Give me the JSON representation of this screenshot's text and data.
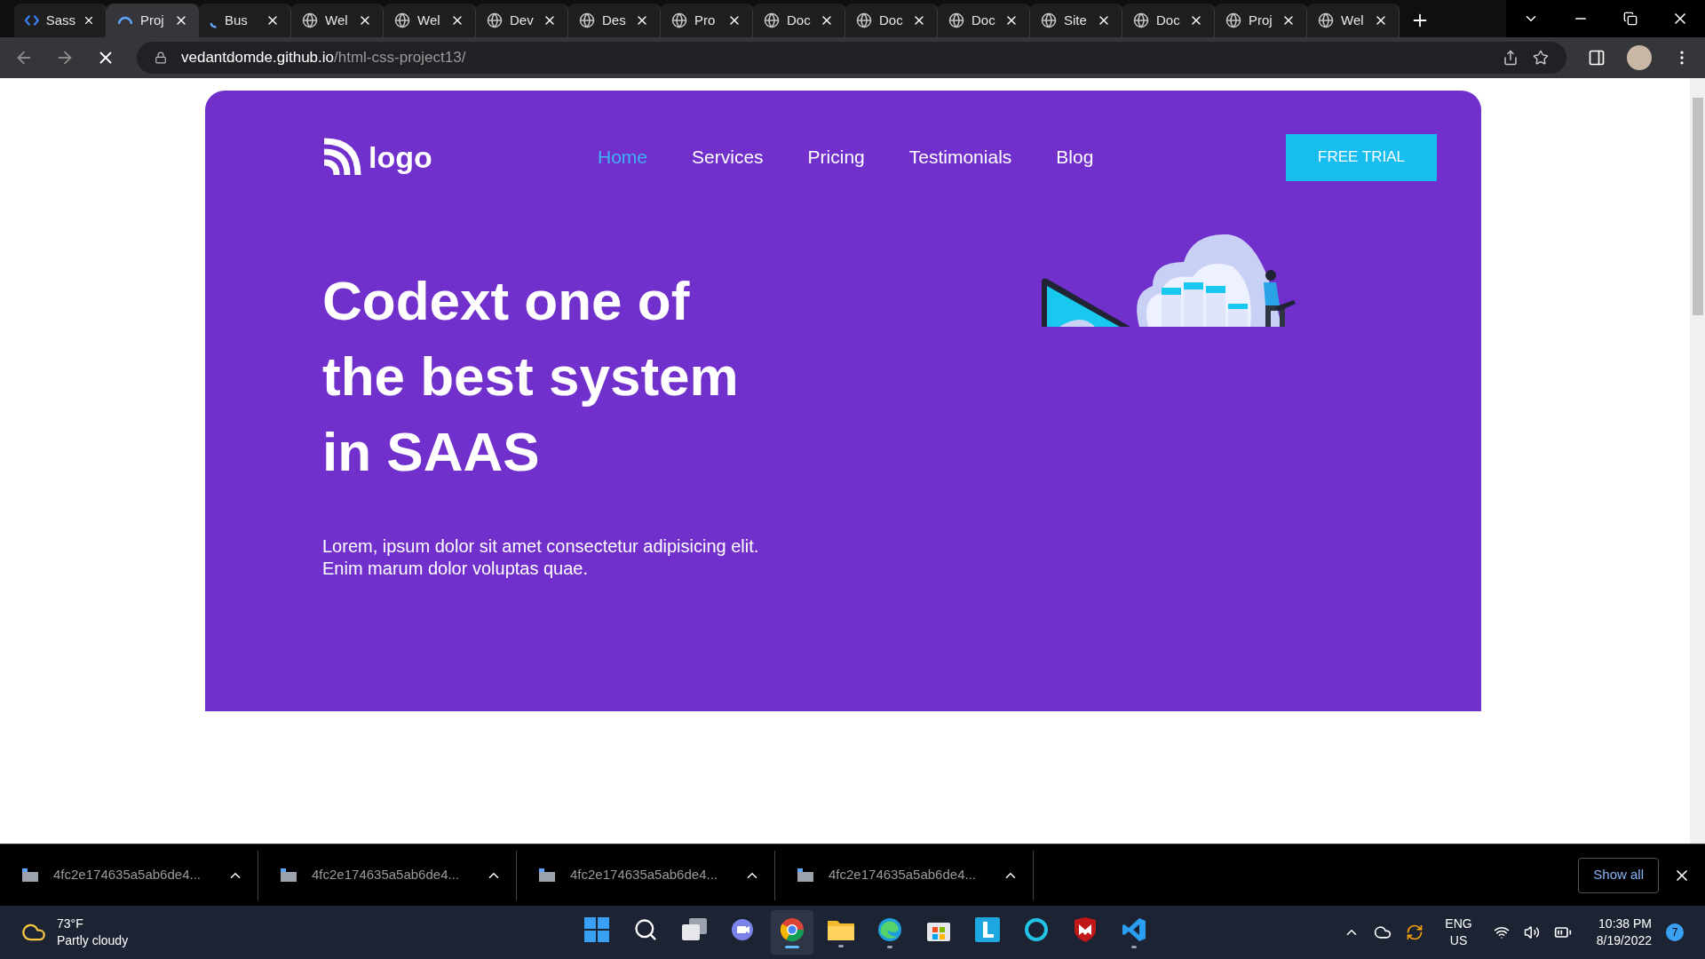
{
  "browser": {
    "tabs": [
      {
        "title": "Sass",
        "kind": "code",
        "selected": false
      },
      {
        "title": "Proj",
        "kind": "spinner",
        "selected": true
      },
      {
        "title": "Bus",
        "kind": "loading",
        "selected": false
      },
      {
        "title": "Wel",
        "kind": "globe",
        "selected": false
      },
      {
        "title": "Wel",
        "kind": "globe",
        "selected": false
      },
      {
        "title": "Dev",
        "kind": "globe",
        "selected": false
      },
      {
        "title": "Des",
        "kind": "globe",
        "selected": false
      },
      {
        "title": "Pro",
        "kind": "globe",
        "selected": false
      },
      {
        "title": "Doc",
        "kind": "globe",
        "selected": false
      },
      {
        "title": "Doc",
        "kind": "globe",
        "selected": false
      },
      {
        "title": "Doc",
        "kind": "globe",
        "selected": false
      },
      {
        "title": "Site",
        "kind": "globe",
        "selected": false
      },
      {
        "title": "Doc",
        "kind": "globe",
        "selected": false
      },
      {
        "title": "Proj",
        "kind": "globe",
        "selected": false
      },
      {
        "title": "Wel",
        "kind": "globe",
        "selected": false
      }
    ],
    "address": {
      "host": "vedantdomde.github.io",
      "path": "/html-css-project13/"
    }
  },
  "page": {
    "logo": "logo",
    "nav": [
      {
        "label": "Home",
        "selected": true
      },
      {
        "label": "Services",
        "selected": false
      },
      {
        "label": "Pricing",
        "selected": false
      },
      {
        "label": "Testimonials",
        "selected": false
      },
      {
        "label": "Blog",
        "selected": false
      }
    ],
    "cta": "FREE TRIAL",
    "headline": "Codext one of the best system in SAAS",
    "text": "Lorem, ipsum dolor sit amet consectetur adipisicing elit. Enim marum dolor voluptas quae."
  },
  "downloads": {
    "items": [
      "4fc2e174635a5ab6de4...",
      "4fc2e174635a5ab6de4...",
      "4fc2e174635a5ab6de4...",
      "4fc2e174635a5ab6de4..."
    ],
    "show_all": "Show all"
  },
  "taskbar": {
    "weather": {
      "temp": "73°F",
      "condition": "Partly cloudy"
    },
    "apps": [
      {
        "kind": "start",
        "running": false,
        "selected": false
      },
      {
        "kind": "search",
        "running": false,
        "selected": false
      },
      {
        "kind": "taskview",
        "running": false,
        "selected": false
      },
      {
        "kind": "chat",
        "running": false,
        "selected": false
      },
      {
        "kind": "chrome",
        "running": true,
        "selected": true
      },
      {
        "kind": "files",
        "running": true,
        "selected": false
      },
      {
        "kind": "edge",
        "running": true,
        "selected": false
      },
      {
        "kind": "store",
        "running": false,
        "selected": false
      },
      {
        "kind": "letter",
        "running": false,
        "selected": false
      },
      {
        "kind": "ring",
        "running": false,
        "selected": false
      },
      {
        "kind": "shield",
        "running": false,
        "selected": false
      },
      {
        "kind": "code",
        "running": true,
        "selected": false
      }
    ],
    "language": [
      "ENG",
      "US"
    ],
    "time": "10:38 PM",
    "date": "8/19/2022",
    "notifications": "7"
  }
}
